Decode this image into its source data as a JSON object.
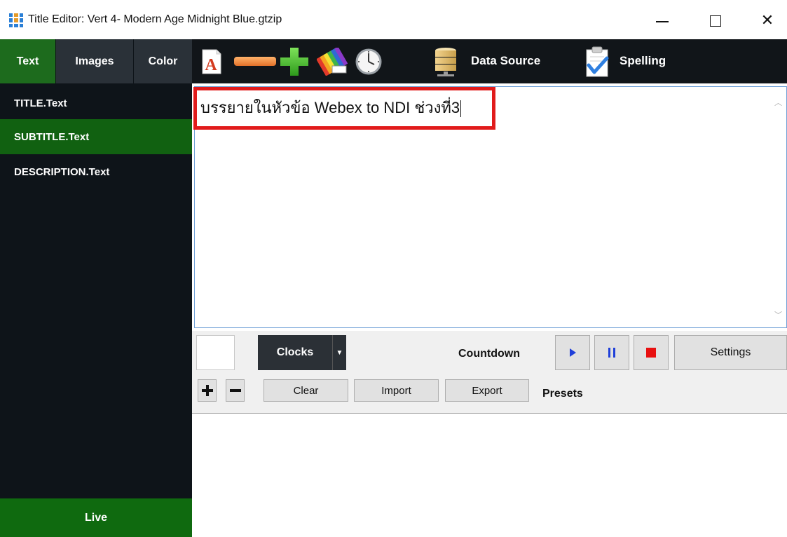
{
  "window": {
    "title": "Title Editor: Vert 4- Modern Age Midnight Blue.gtzip"
  },
  "left_panel": {
    "tabs": [
      {
        "label": "Text",
        "active": true
      },
      {
        "label": "Images",
        "active": false
      },
      {
        "label": "Color",
        "active": false
      }
    ],
    "layers": [
      {
        "label": "TITLE.Text",
        "selected": false
      },
      {
        "label": "SUBTITLE.Text",
        "selected": true
      },
      {
        "label": "DESCRIPTION.Text",
        "selected": false
      }
    ],
    "live_label": "Live"
  },
  "toolbar": {
    "icons": [
      "font-icon",
      "remove-icon",
      "add-icon",
      "color-palette-icon",
      "clock-icon",
      "database-icon",
      "spelling-icon"
    ],
    "data_source_label": "Data Source",
    "spelling_label": "Spelling"
  },
  "editor": {
    "text": "บรรยายในหัวข้อ  Webex to NDI ช่วงที่3"
  },
  "controls": {
    "clocks_label": "Clocks",
    "countdown_label": "Countdown",
    "settings_label": "Settings",
    "clear_label": "Clear",
    "import_label": "Import",
    "export_label": "Export",
    "presets_label": "Presets"
  },
  "colors": {
    "active_green": "#1d6b1d",
    "selected_green": "#116111",
    "dark_bg": "#0e1419",
    "highlight_red": "#e11b1b",
    "play_blue": "#1f3fd9",
    "stop_red": "#e81010"
  }
}
